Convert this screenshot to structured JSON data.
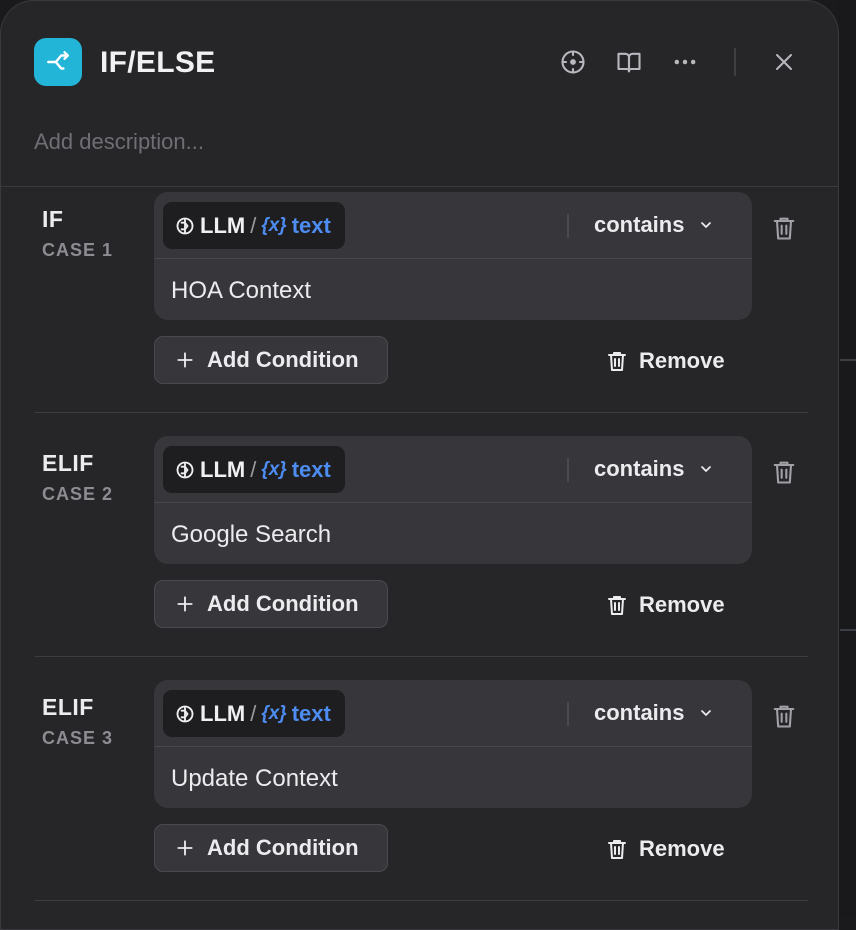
{
  "header": {
    "title": "IF/ELSE",
    "description_placeholder": "Add description..."
  },
  "icons": {
    "app": "branch-arrow-icon",
    "locate": "crosshair-icon",
    "docs": "book-open-icon",
    "more": "more-horizontal-icon",
    "close": "close-icon",
    "delete": "trash-icon",
    "add": "plus-icon",
    "dropdown": "chevron-down-icon",
    "variable": "variable-braces-icon",
    "node": "llm-node-icon"
  },
  "colors": {
    "accent_icon_bg": "#23b5d8",
    "variable_blue": "#4d8cf0",
    "panel_bg": "#262629",
    "box_bg": "#37373b"
  },
  "cases": [
    {
      "keyword": "IF",
      "case_label": "CASE 1",
      "condition": {
        "node": "LLM",
        "separator": "/",
        "var_symbol": "{x}",
        "variable": "text",
        "operator": "contains",
        "value": "HOA Context"
      },
      "add_condition_label": "Add Condition",
      "remove_label": "Remove"
    },
    {
      "keyword": "ELIF",
      "case_label": "CASE 2",
      "condition": {
        "node": "LLM",
        "separator": "/",
        "var_symbol": "{x}",
        "variable": "text",
        "operator": "contains",
        "value": "Google Search"
      },
      "add_condition_label": "Add Condition",
      "remove_label": "Remove"
    },
    {
      "keyword": "ELIF",
      "case_label": "CASE 3",
      "condition": {
        "node": "LLM",
        "separator": "/",
        "var_symbol": "{x}",
        "variable": "text",
        "operator": "contains",
        "value": "Update Context"
      },
      "add_condition_label": "Add Condition",
      "remove_label": "Remove"
    }
  ]
}
